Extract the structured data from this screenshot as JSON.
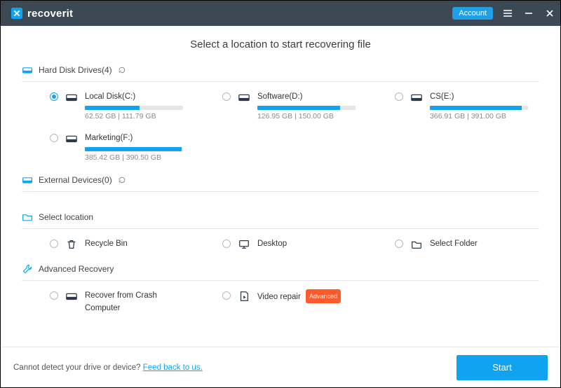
{
  "header": {
    "brand": "recoverit",
    "account_label": "Account"
  },
  "page": {
    "title": "Select a location to start recovering file"
  },
  "sections": {
    "hdd_label": "Hard Disk Drives(4)",
    "ext_label": "External Devices(0)",
    "sel_label": "Select location",
    "adv_label": "Advanced Recovery"
  },
  "drives": [
    {
      "name": "Local Disk(C:)",
      "used": 62.52,
      "total": 111.79,
      "cap": "62.52  GB | 111.79  GB",
      "selected": true
    },
    {
      "name": "Software(D:)",
      "used": 126.95,
      "total": 150.0,
      "cap": "126.95  GB | 150.00  GB",
      "selected": false
    },
    {
      "name": "CS(E:)",
      "used": 366.91,
      "total": 391.0,
      "cap": "366.91  GB | 391.00  GB",
      "selected": false
    },
    {
      "name": "Marketing(F:)",
      "used": 385.42,
      "total": 390.5,
      "cap": "385.42  GB | 390.50  GB",
      "selected": false
    }
  ],
  "locations": {
    "recycle": "Recycle Bin",
    "desktop": "Desktop",
    "folder": "Select Folder"
  },
  "advanced": {
    "crash": "Recover from Crash Computer",
    "video": "Video repair",
    "video_badge": "Advanced"
  },
  "footer": {
    "text": "Cannot detect your drive or device? ",
    "link": "Feed back to us.",
    "start_label": "Start"
  },
  "colors": {
    "accent": "#12a3f0",
    "titlebar": "#3c4854"
  }
}
